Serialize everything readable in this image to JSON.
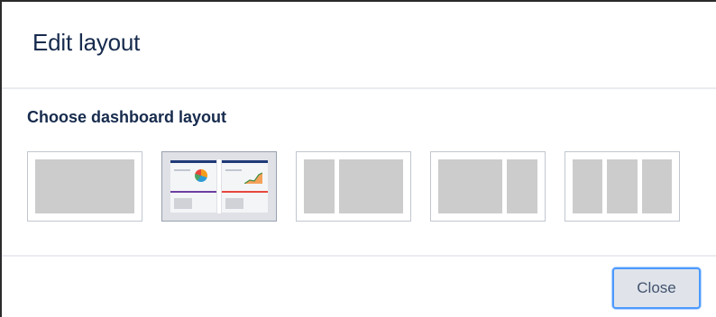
{
  "dialog": {
    "title": "Edit layout"
  },
  "layout_picker": {
    "heading": "Choose dashboard layout",
    "selected_index": 1,
    "options": [
      {
        "id": "one-column"
      },
      {
        "id": "two-column-equal"
      },
      {
        "id": "two-column-narrow-wide"
      },
      {
        "id": "two-column-wide-narrow"
      },
      {
        "id": "three-column"
      }
    ]
  },
  "footer": {
    "close_label": "Close"
  },
  "colors": {
    "title_text": "#172b4d",
    "preview_bar_left": "#1f3a78",
    "preview_bar_right": "#1f3a78",
    "preview_divider_left": "#6b3fa0",
    "preview_divider_right": "#e8473c",
    "button_focus": "#4c9aff"
  }
}
